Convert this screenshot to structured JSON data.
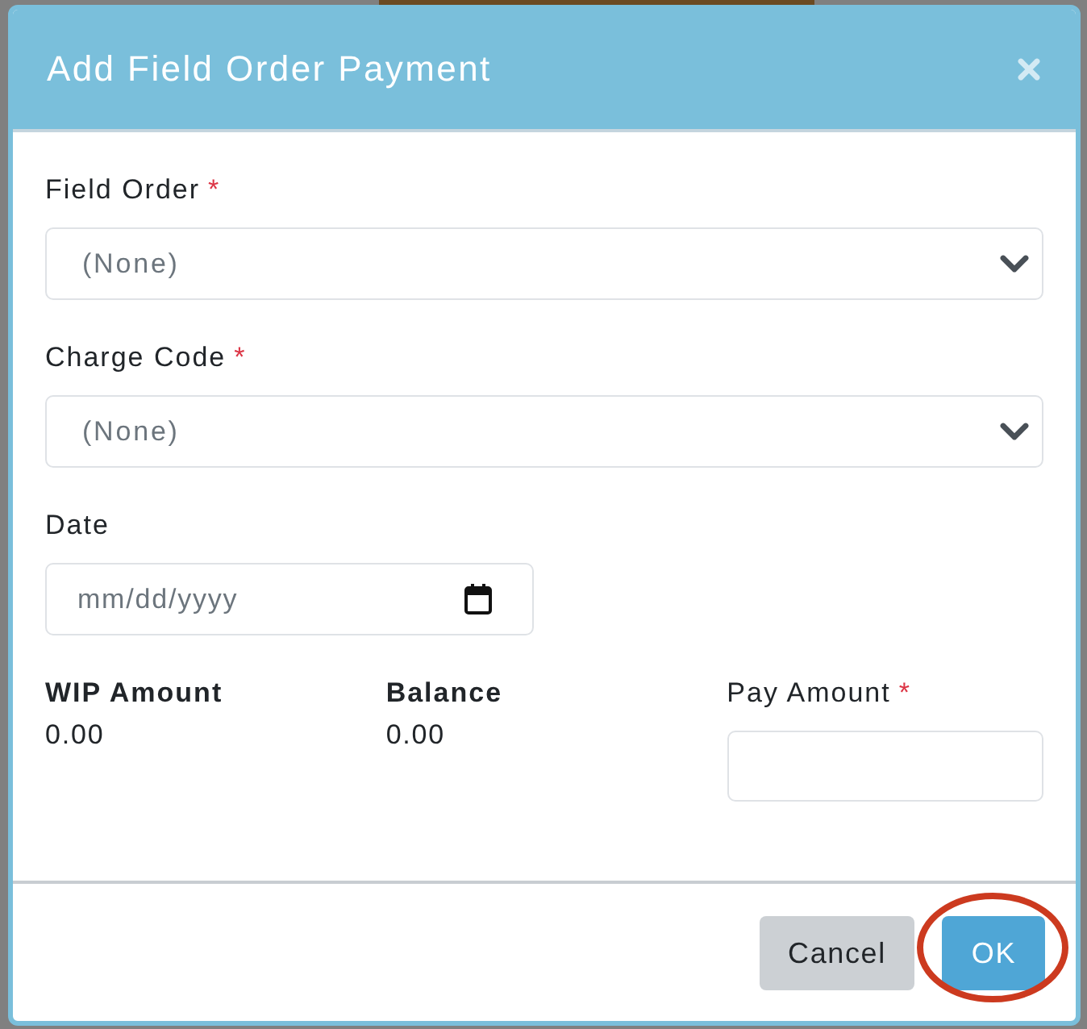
{
  "dialog": {
    "title": "Add Field Order Payment"
  },
  "fields": [
    {
      "kind": "select",
      "label": "Field Order",
      "required_mark": "*",
      "value": "(None)"
    },
    {
      "kind": "select",
      "label": "Charge Code",
      "required_mark": "*",
      "value": "(None)"
    },
    {
      "kind": "date",
      "label": "Date",
      "placeholder": "mm/dd/yyyy"
    }
  ],
  "amounts": [
    {
      "kind": "readout",
      "label": "WIP Amount",
      "value": "0.00"
    },
    {
      "kind": "readout",
      "label": "Balance",
      "value": "0.00"
    },
    {
      "kind": "input",
      "label": "Pay Amount",
      "required_mark": "*"
    }
  ],
  "footer": {
    "buttons": [
      {
        "kind": "secondary",
        "label": "Cancel",
        "highlighted": false
      },
      {
        "kind": "primary",
        "label": "OK",
        "highlighted": true
      }
    ]
  }
}
